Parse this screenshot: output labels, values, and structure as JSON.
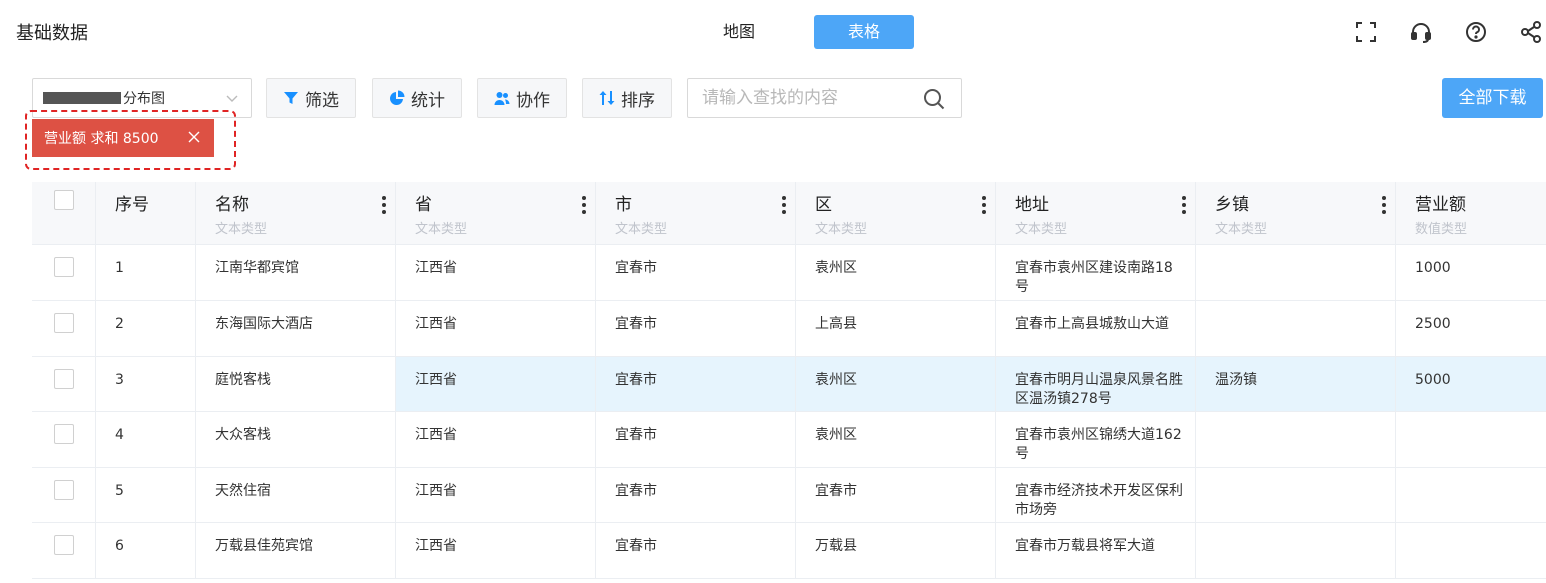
{
  "header": {
    "title": "基础数据",
    "tabs": [
      {
        "label": "地图",
        "active": false
      },
      {
        "label": "表格",
        "active": true
      }
    ],
    "icons": [
      "fullscreen-icon",
      "headset-icon",
      "help-icon",
      "share-icon"
    ]
  },
  "toolbar": {
    "layer_select_value": "分布图",
    "filter_label": "筛选",
    "stats_label": "统计",
    "collab_label": "协作",
    "sort_label": "排序",
    "search_placeholder": "请输入查找的内容",
    "download_label": "全部下载"
  },
  "filter_tag": {
    "label": "营业额 求和 8500"
  },
  "colors": {
    "accent": "#4da6f7",
    "tag_red": "#dd5144",
    "highlight_row": "#e6f4fd"
  },
  "table": {
    "columns": [
      {
        "title": "序号",
        "type": ""
      },
      {
        "title": "名称",
        "type": "文本类型"
      },
      {
        "title": "省",
        "type": "文本类型"
      },
      {
        "title": "市",
        "type": "文本类型"
      },
      {
        "title": "区",
        "type": "文本类型"
      },
      {
        "title": "地址",
        "type": "文本类型"
      },
      {
        "title": "乡镇",
        "type": "文本类型"
      },
      {
        "title": "营业额",
        "type": "数值类型"
      }
    ],
    "rows": [
      {
        "no": "1",
        "name": "江南华都宾馆",
        "province": "江西省",
        "city": "宜春市",
        "district": "袁州区",
        "address": "宜春市袁州区建设南路18号",
        "town": "",
        "revenue": "1000"
      },
      {
        "no": "2",
        "name": "东海国际大酒店",
        "province": "江西省",
        "city": "宜春市",
        "district": "上高县",
        "address": "宜春市上高县城敖山大道",
        "town": "",
        "revenue": "2500"
      },
      {
        "no": "3",
        "name": "庭悦客栈",
        "province": "江西省",
        "city": "宜春市",
        "district": "袁州区",
        "address": "宜春市明月山温泉风景名胜区温汤镇278号",
        "town": "温汤镇",
        "revenue": "5000"
      },
      {
        "no": "4",
        "name": "大众客栈",
        "province": "江西省",
        "city": "宜春市",
        "district": "袁州区",
        "address": "宜春市袁州区锦绣大道162号",
        "town": "",
        "revenue": ""
      },
      {
        "no": "5",
        "name": "天然住宿",
        "province": "江西省",
        "city": "宜春市",
        "district": "宜春市",
        "address": "宜春市经济技术开发区保利市场旁",
        "town": "",
        "revenue": ""
      },
      {
        "no": "6",
        "name": "万载县佳苑宾馆",
        "province": "江西省",
        "city": "宜春市",
        "district": "万载县",
        "address": "宜春市万载县将军大道",
        "town": "",
        "revenue": ""
      }
    ]
  }
}
